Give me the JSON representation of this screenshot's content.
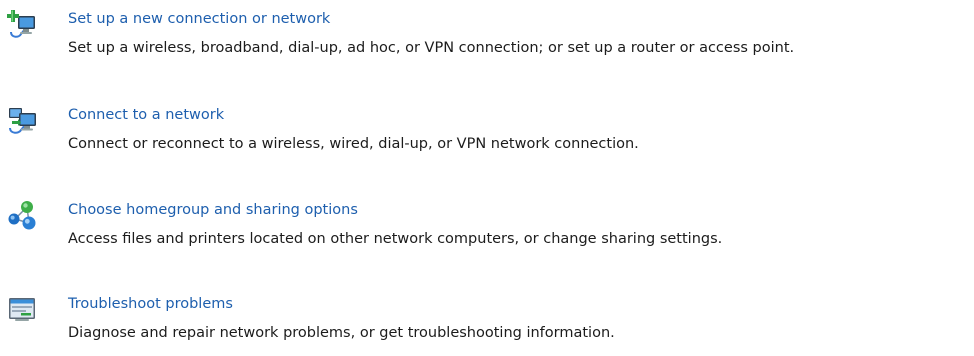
{
  "tasks": [
    {
      "icon": "new-connection-icon",
      "title": "Set up a new connection or network",
      "description": "Set up a wireless, broadband, dial-up, ad hoc, or VPN connection; or set up a router or access point."
    },
    {
      "icon": "connect-network-icon",
      "title": "Connect to a network",
      "description": "Connect or reconnect to a wireless, wired, dial-up, or VPN network connection."
    },
    {
      "icon": "homegroup-icon",
      "title": "Choose homegroup and sharing options",
      "description": "Access files and printers located on other network computers, or change sharing settings."
    },
    {
      "icon": "troubleshoot-icon",
      "title": "Troubleshoot problems",
      "description": "Diagnose and repair network problems, or get troubleshooting information."
    }
  ],
  "colors": {
    "link": "#1e5fae",
    "text": "#1c1c1c",
    "background": "#ffffff"
  }
}
